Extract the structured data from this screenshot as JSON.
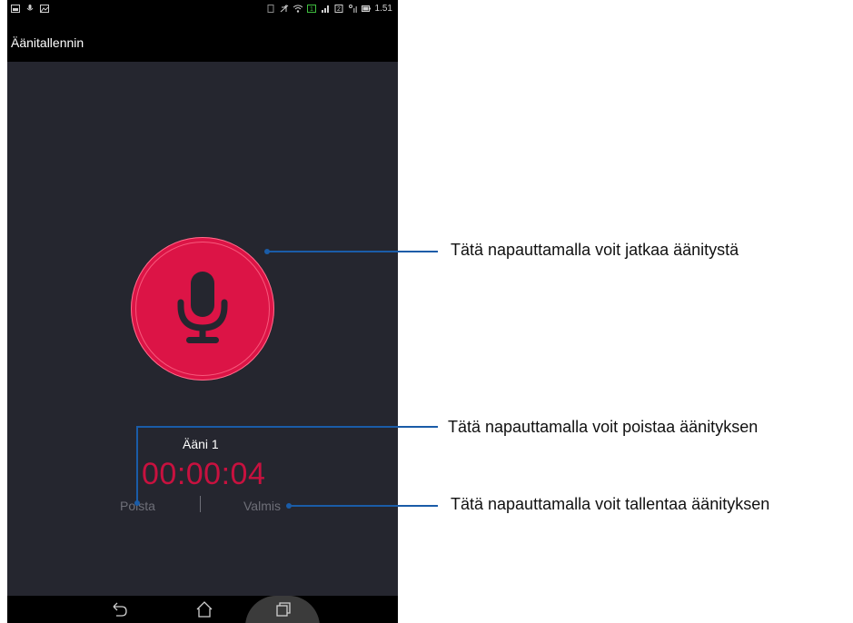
{
  "statusbar": {
    "time": "1.51",
    "left_icons": [
      "image-icon",
      "mic-icon",
      "gallery-icon"
    ],
    "right_icons": [
      "sim-icon",
      "mute-icon",
      "wifi-icon",
      "data-icon",
      "signal-icon",
      "sim2-icon",
      "signal2-icon",
      "battery-icon"
    ]
  },
  "appbar": {
    "title": "Äänitallennin"
  },
  "recorder": {
    "recording_name": "Ääni 1",
    "timer": "00:00:04",
    "delete_label": "Poista",
    "separator": "|",
    "done_label": "Valmis"
  },
  "navbar": {
    "buttons": [
      "back-icon",
      "home-icon",
      "recent-apps-icon"
    ]
  },
  "callouts": {
    "resume": "Tätä napauttamalla voit jatkaa äänitystä",
    "delete": "Tätä napauttamalla voit poistaa äänityksen",
    "save": "Tätä napauttamalla voit tallentaa äänityksen"
  },
  "colors": {
    "background": "#25262f",
    "accent_red": "#dc1446",
    "timer_red": "#c8113f",
    "callout_blue": "#1a5ca8"
  }
}
